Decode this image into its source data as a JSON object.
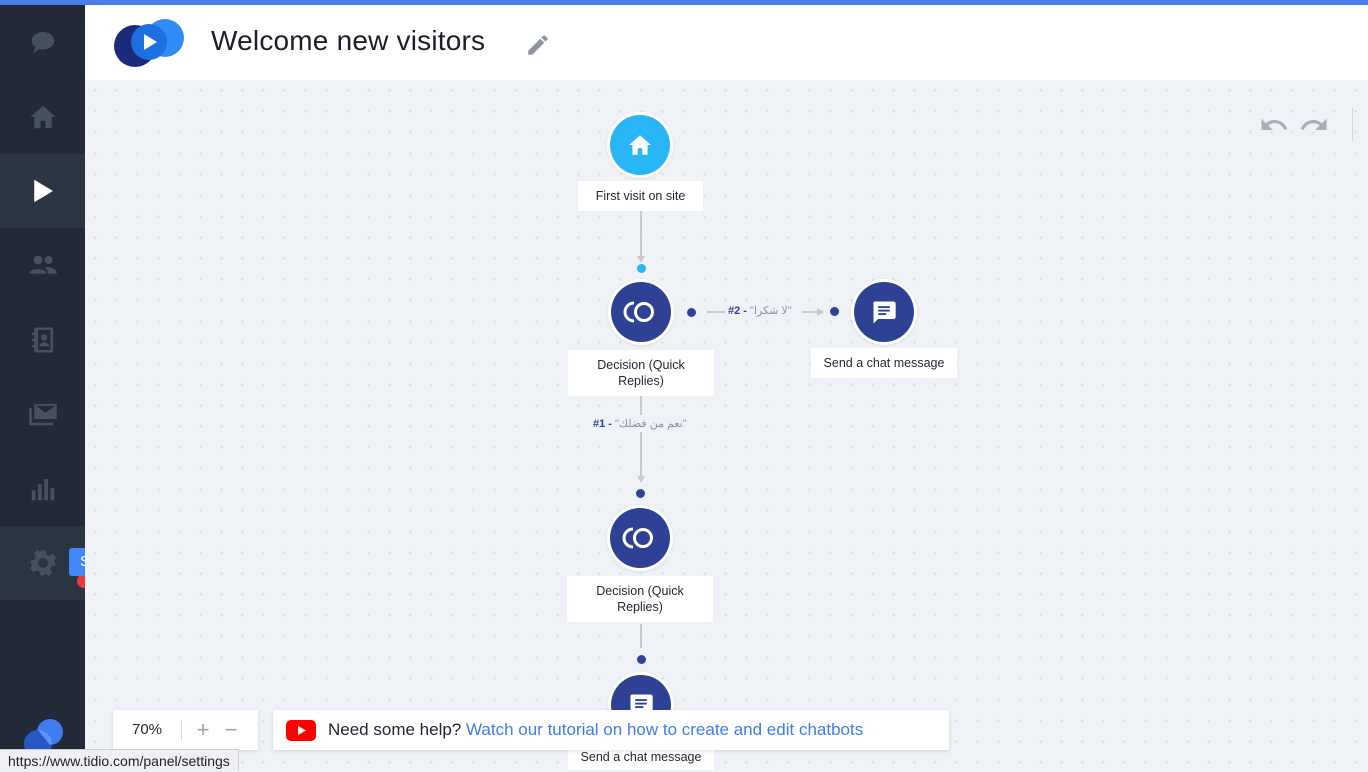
{
  "header": {
    "title": "Welcome new visitors"
  },
  "sidebar": {
    "items": [
      {
        "name": "chat"
      },
      {
        "name": "home"
      },
      {
        "name": "chatbots"
      },
      {
        "name": "visitors"
      },
      {
        "name": "contacts"
      },
      {
        "name": "mailing"
      },
      {
        "name": "analytics"
      },
      {
        "name": "settings"
      }
    ],
    "tooltip": "SETTINGS"
  },
  "flow": {
    "trigger_label": "First visit on site",
    "decision1_label": "Decision (Quick Replies)",
    "decision2_label": "Decision (Quick Replies)",
    "message1_label": "Send a chat message",
    "message2_label": "Send a chat message",
    "edge_right": {
      "index": "#2 -",
      "text": "\"لا شكرا\""
    },
    "edge_down": {
      "index": "#1 -",
      "text": "\"نعم من فضلك\""
    }
  },
  "zoom": {
    "value": "70%",
    "plus": "+",
    "minus": "−"
  },
  "help": {
    "prefix": "Need some help?",
    "link": "Watch our tutorial on how to create and edit chatbots"
  },
  "status_url": "https://www.tidio.com/panel/settings",
  "colors": {
    "accent": "#4287f5",
    "node_dark": "#2f4194",
    "trigger": "#29b6f6",
    "sidebar": "#222a37"
  }
}
